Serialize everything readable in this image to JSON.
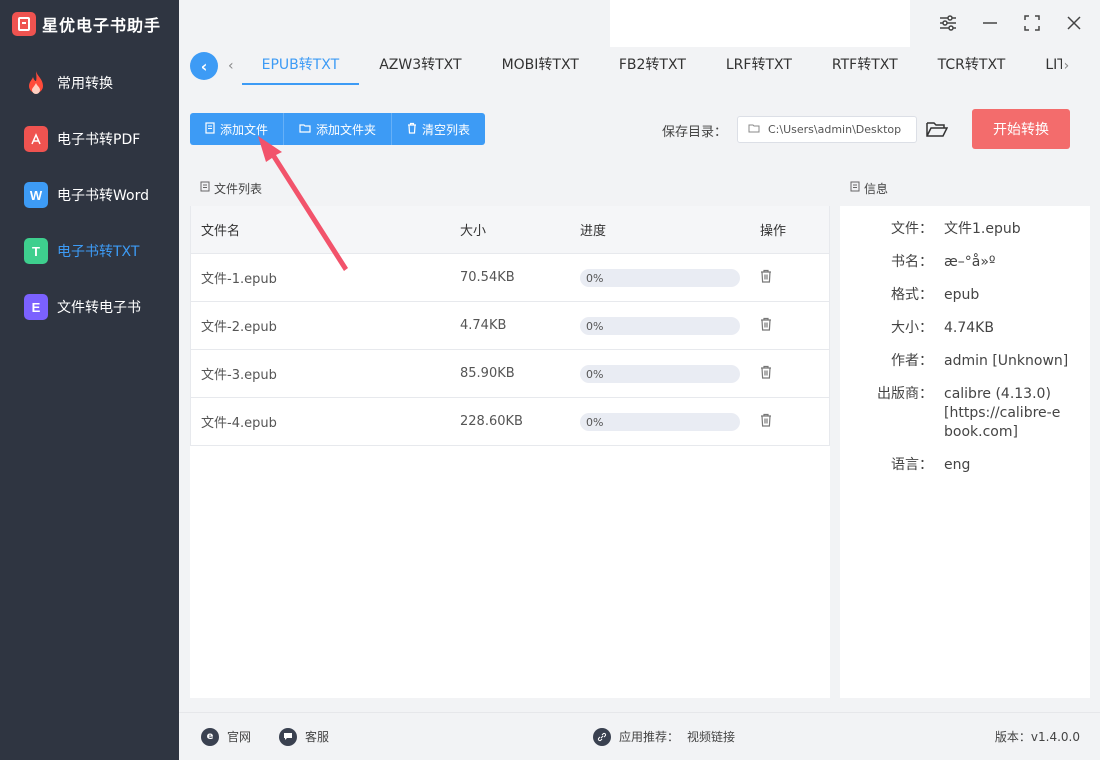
{
  "app": {
    "title": "星优电子书助手"
  },
  "sidebar": {
    "items": [
      {
        "label": "常用转换",
        "icon": "fire-icon"
      },
      {
        "label": "电子书转PDF",
        "icon": "pdf-icon"
      },
      {
        "label": "电子书转Word",
        "icon": "word-icon"
      },
      {
        "label": "电子书转TXT",
        "icon": "txt-icon",
        "active": true
      },
      {
        "label": "文件转电子书",
        "icon": "ebook-icon"
      }
    ]
  },
  "tabs": [
    "EPUB转TXT",
    "AZW3转TXT",
    "MOBI转TXT",
    "FB2转TXT",
    "LRF转TXT",
    "RTF转TXT",
    "TCR转TXT",
    "LIT转T"
  ],
  "toolbar": {
    "add_file": "添加文件",
    "add_folder": "添加文件夹",
    "clear_list": "清空列表"
  },
  "save": {
    "label": "保存目录：",
    "path": "C:\\Users\\admin\\Desktop",
    "start_label": "开始转换"
  },
  "file_list": {
    "title": "文件列表",
    "columns": {
      "name": "文件名",
      "size": "大小",
      "progress": "进度",
      "op": "操作"
    },
    "rows": [
      {
        "name": "文件-1.epub",
        "size": "70.54KB",
        "progress": "0%",
        "fill": 0
      },
      {
        "name": "文件-2.epub",
        "size": "4.74KB",
        "progress": "0%",
        "fill": 0
      },
      {
        "name": "文件-3.epub",
        "size": "85.90KB",
        "progress": "0%",
        "fill": 0
      },
      {
        "name": "文件-4.epub",
        "size": "228.60KB",
        "progress": "0%",
        "fill": 0
      }
    ]
  },
  "info": {
    "title": "信息",
    "rows": [
      {
        "k": "文件：",
        "v": "文件1.epub"
      },
      {
        "k": "书名：",
        "v": "æ–°å»º"
      },
      {
        "k": "格式：",
        "v": "epub"
      },
      {
        "k": "大小：",
        "v": "4.74KB"
      },
      {
        "k": "作者：",
        "v": "admin [Unknown]"
      },
      {
        "k": "出版商：",
        "v": "calibre (4.13.0) [https://calibre-ebook.com]"
      },
      {
        "k": "语言：",
        "v": "eng"
      }
    ]
  },
  "footer": {
    "website": "官网",
    "support": "客服",
    "recommend_label": "应用推荐：",
    "recommend_link": "视频链接",
    "version": "版本：v1.4.0.0"
  },
  "colors": {
    "accent": "#3d9bf5",
    "start": "#f36c6c",
    "sidebar": "#2f3541",
    "arrow": "#f2536b"
  }
}
